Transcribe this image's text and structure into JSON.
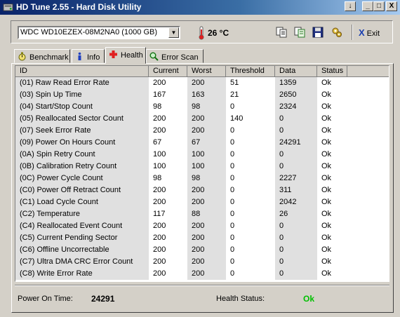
{
  "window": {
    "title": "HD Tune 2.55 - Hard Disk Utility",
    "pin_glyph": "↓",
    "minimize_glyph": "_",
    "maximize_glyph": "□",
    "close_glyph": "X"
  },
  "toolbar": {
    "drive": "WDC WD10EZEX-08M2NA0 (1000 GB)",
    "temperature": "26 °C",
    "exit_label": "Exit",
    "exit_glyph": "X"
  },
  "tabs": [
    {
      "label": "Benchmark",
      "icon": "stopwatch-icon"
    },
    {
      "label": "Info",
      "icon": "info-icon"
    },
    {
      "label": "Health",
      "icon": "health-cross-icon"
    },
    {
      "label": "Error Scan",
      "icon": "magnifier-icon"
    }
  ],
  "active_tab": "Health",
  "table": {
    "columns": [
      "ID",
      "Current",
      "Worst",
      "Threshold",
      "Data",
      "Status"
    ],
    "rows": [
      [
        "(01) Raw Read Error Rate",
        "200",
        "200",
        "51",
        "1359",
        "Ok"
      ],
      [
        "(03) Spin Up Time",
        "167",
        "163",
        "21",
        "2650",
        "Ok"
      ],
      [
        "(04) Start/Stop Count",
        "98",
        "98",
        "0",
        "2324",
        "Ok"
      ],
      [
        "(05) Reallocated Sector Count",
        "200",
        "200",
        "140",
        "0",
        "Ok"
      ],
      [
        "(07) Seek Error Rate",
        "200",
        "200",
        "0",
        "0",
        "Ok"
      ],
      [
        "(09) Power On Hours Count",
        "67",
        "67",
        "0",
        "24291",
        "Ok"
      ],
      [
        "(0A) Spin Retry Count",
        "100",
        "100",
        "0",
        "0",
        "Ok"
      ],
      [
        "(0B) Calibration Retry Count",
        "100",
        "100",
        "0",
        "0",
        "Ok"
      ],
      [
        "(0C) Power Cycle Count",
        "98",
        "98",
        "0",
        "2227",
        "Ok"
      ],
      [
        "(C0) Power Off Retract Count",
        "200",
        "200",
        "0",
        "311",
        "Ok"
      ],
      [
        "(C1) Load Cycle Count",
        "200",
        "200",
        "0",
        "2042",
        "Ok"
      ],
      [
        "(C2) Temperature",
        "117",
        "88",
        "0",
        "26",
        "Ok"
      ],
      [
        "(C4) Reallocated Event Count",
        "200",
        "200",
        "0",
        "0",
        "Ok"
      ],
      [
        "(C5) Current Pending Sector",
        "200",
        "200",
        "0",
        "0",
        "Ok"
      ],
      [
        "(C6) Offline Uncorrectable",
        "200",
        "200",
        "0",
        "0",
        "Ok"
      ],
      [
        "(C7) Ultra DMA CRC Error Count",
        "200",
        "200",
        "0",
        "0",
        "Ok"
      ],
      [
        "(C8) Write Error Rate",
        "200",
        "200",
        "0",
        "0",
        "Ok"
      ]
    ]
  },
  "footer": {
    "power_on_time_label": "Power On Time:",
    "power_on_time_value": "24291",
    "health_status_label": "Health Status:",
    "health_status_value": "Ok"
  },
  "colors": {
    "window_bg": "#d4d0c8",
    "titlebar": "#0a246a",
    "health_ok": "#00c000"
  }
}
